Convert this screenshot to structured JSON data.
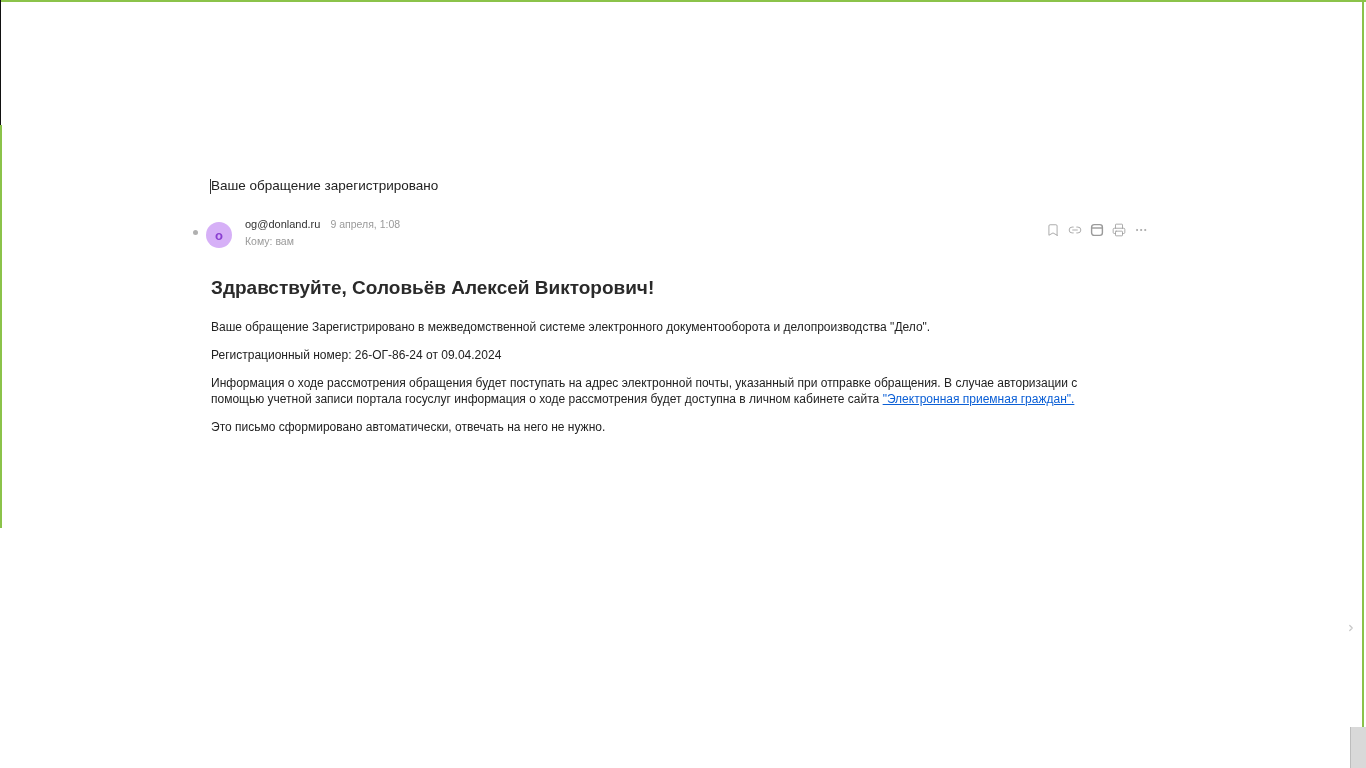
{
  "message": {
    "subject": "Ваше обращение зарегистрировано",
    "unread": true,
    "sender": {
      "initial": "o",
      "email": "og@donland.ru"
    },
    "date": "9 апреля, 1:08",
    "recipient": "Кому: вам",
    "actions": [
      {
        "kind": "bookmark"
      },
      {
        "kind": "link"
      },
      {
        "kind": "calendar"
      },
      {
        "kind": "print"
      },
      {
        "kind": "more"
      }
    ]
  },
  "body": {
    "greeting": "Здравствуйте, Соловьёв Алексей Викторович!",
    "paragraphs": [
      {
        "text": "Ваше обращение Зарегистрировано в межведомственной системе электронного документооборота и делопроизводства \"Дело\"."
      },
      {
        "text": "Регистрационный номер: 26-ОГ-86-24 от 09.04.2024"
      },
      {
        "text": "Информация о ходе рассмотрения обращения будет поступать на адрес электронной почты, указанный при отправке обращения. В случае авторизации с помощью учетной записи портала госуслуг информация о ходе рассмотрения будет доступна в личном кабинете сайта",
        "link": "\"Электронная приемная граждан\"."
      },
      {
        "text": "Это письмо сформировано автоматически, отвечать на него не нужно."
      }
    ]
  }
}
